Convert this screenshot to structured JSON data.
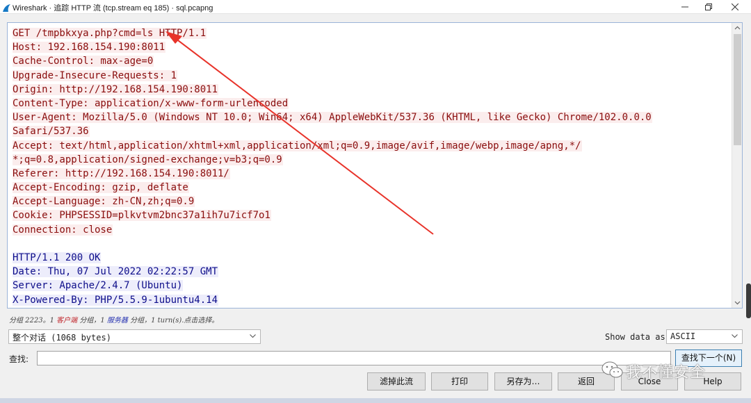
{
  "window": {
    "title": "Wireshark · 追踪 HTTP 流 (tcp.stream eq 185) · sql.pcapng"
  },
  "request_lines": [
    "GET /tmpbkxya.php?cmd=ls HTTP/1.1",
    "Host: 192.168.154.190:8011",
    "Cache-Control: max-age=0",
    "Upgrade-Insecure-Requests: 1",
    "Origin: http://192.168.154.190:8011",
    "Content-Type: application/x-www-form-urlencoded",
    "User-Agent: Mozilla/5.0 (Windows NT 10.0; Win64; x64) AppleWebKit/537.36 (KHTML, like Gecko) Chrome/102.0.0.0",
    "Safari/537.36",
    "Accept: text/html,application/xhtml+xml,application/xml;q=0.9,image/avif,image/webp,image/apng,*/",
    "*;q=0.8,application/signed-exchange;v=b3;q=0.9",
    "Referer: http://192.168.154.190:8011/",
    "Accept-Encoding: gzip, deflate",
    "Accept-Language: zh-CN,zh;q=0.9",
    "Cookie: PHPSESSID=plkvtvm2bnc37a1ih7u7icf7o1",
    "Connection: close"
  ],
  "response_lines": [
    "HTTP/1.1 200 OK",
    "Date: Thu, 07 Jul 2022 02:22:57 GMT",
    "Server: Apache/2.4.7 (Ubuntu)",
    "X-Powered-By: PHP/5.5.9-1ubuntu4.14"
  ],
  "status": {
    "prefix": "分组 2223。1 ",
    "client": "客户端",
    "mid1": " 分组，1 ",
    "server": "服务器",
    "suffix": " 分组，1 turn(s).点击选择。"
  },
  "conversation_select": "整个对话 (1068 bytes)",
  "show_data_label": "Show data as",
  "show_data_value": "ASCII",
  "find": {
    "label": "查找:",
    "value": "",
    "next_button": "查找下一个(N)"
  },
  "buttons": {
    "filter_out": "滤掉此流",
    "print": "打印",
    "save_as": "另存为…",
    "back": "返回",
    "close": "Close",
    "help": "Help"
  },
  "watermark": "我不懂安全",
  "colors": {
    "request_text": "#8a0d0d",
    "request_bg": "#fbeded",
    "response_text": "#0d0d8a",
    "response_bg": "#ededfb",
    "annotation_arrow": "#e8332a"
  },
  "icons": [
    "wireshark-fin-icon",
    "minimize-icon",
    "restore-icon",
    "close-icon",
    "chevron-down-icon",
    "wechat-icon"
  ]
}
